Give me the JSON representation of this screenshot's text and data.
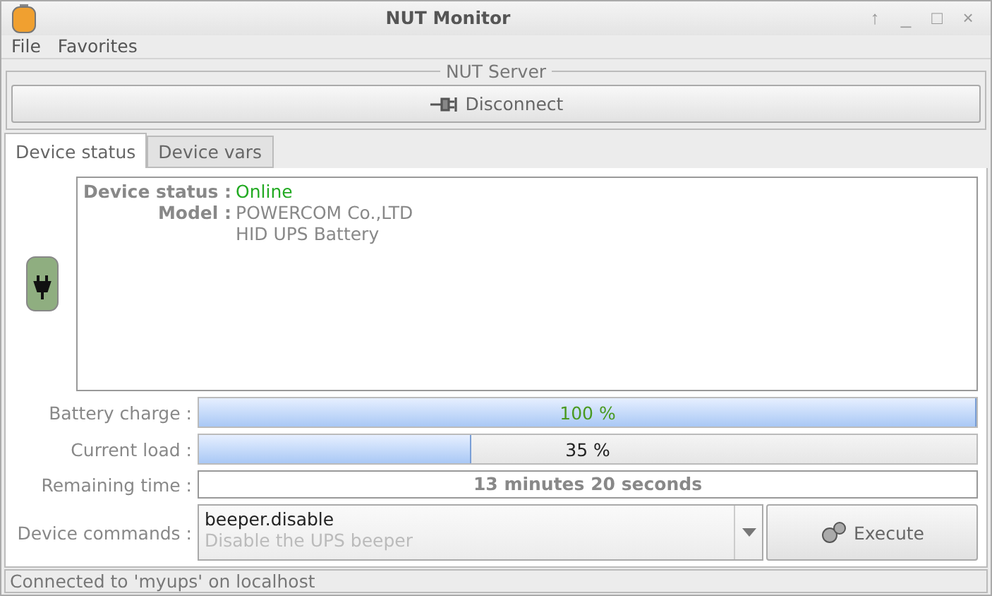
{
  "window": {
    "title": "NUT Monitor",
    "controls": [
      "↑",
      "_",
      "□",
      "×"
    ]
  },
  "menu": [
    {
      "label": "File"
    },
    {
      "label": "Favorites"
    }
  ],
  "server": {
    "legend": "NUT Server",
    "button": {
      "label": "Disconnect"
    }
  },
  "tabs": [
    {
      "label": "Device status",
      "selected": true
    },
    {
      "label": "Device vars",
      "selected": false
    }
  ],
  "status": {
    "fields": [
      {
        "label": "Device status :",
        "values": [
          "Online"
        ],
        "kind": "online"
      },
      {
        "label": "Model :",
        "values": [
          "POWERCOM Co.,LTD",
          "HID UPS Battery"
        ],
        "kind": "plain"
      }
    ]
  },
  "meters": [
    {
      "label": "Battery charge :",
      "level": 1.0,
      "reading": "100 %",
      "kind": "charge"
    },
    {
      "label": "Current load :",
      "level": 0.35,
      "reading": "35 %",
      "kind": "load"
    }
  ],
  "remaining": {
    "label": "Remaining time :",
    "value": "13 minutes 20 seconds"
  },
  "commands": {
    "label": "Device commands :",
    "value": "beeper.disable",
    "description": "Disable the UPS beeper",
    "button": {
      "label": "Execute"
    }
  },
  "status_bar": "Connected to 'myups' on localhost"
}
